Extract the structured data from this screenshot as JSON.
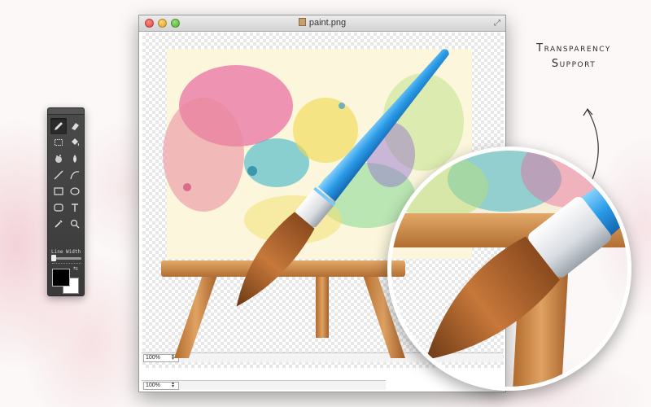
{
  "window": {
    "title": "paint.png"
  },
  "palette": {
    "tools": [
      {
        "name": "pencil-icon",
        "active": true
      },
      {
        "name": "eraser-icon",
        "active": false
      },
      {
        "name": "rect-select-icon",
        "active": false
      },
      {
        "name": "paint-bucket-icon",
        "active": false
      },
      {
        "name": "spray-icon",
        "active": false
      },
      {
        "name": "blur-drop-icon",
        "active": false
      },
      {
        "name": "line-icon",
        "active": false
      },
      {
        "name": "curve-icon",
        "active": false
      },
      {
        "name": "rectangle-icon",
        "active": false
      },
      {
        "name": "ellipse-icon",
        "active": false
      },
      {
        "name": "rounded-rect-icon",
        "active": false
      },
      {
        "name": "text-icon",
        "active": false
      },
      {
        "name": "eyedropper-icon",
        "active": false
      },
      {
        "name": "zoom-icon",
        "active": false
      }
    ],
    "line_width_label": "Line Width",
    "line_width": 0.05,
    "foreground_color": "#000000",
    "background_color": "#ffffff"
  },
  "zoom": {
    "value_1": "100%",
    "value_2": "100%"
  },
  "callout": {
    "line1": "Transparency",
    "line2": "Support"
  }
}
